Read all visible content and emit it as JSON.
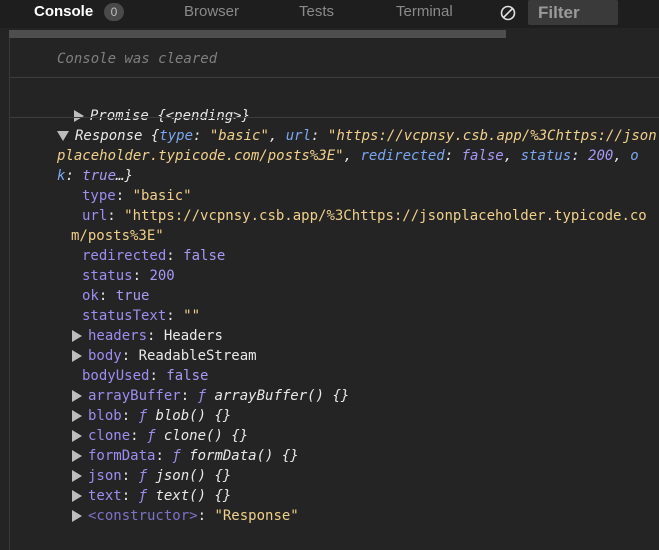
{
  "tabs": {
    "console": "Console",
    "badge": "0",
    "browser": "Browser",
    "tests": "Tests",
    "terminal": "Terminal"
  },
  "filter": {
    "placeholder": "Filter"
  },
  "console": {
    "cleared": "Console was cleared",
    "promise": {
      "label": "Promise",
      "pending": "{<pending>}"
    },
    "response": {
      "label": "Response",
      "summary": {
        "type_key": "type",
        "type_val": "\"basic\"",
        "url_key": "url",
        "url_val_1": "\"https://vcpnsy.csb.app/%3Chttps://json",
        "url_val_2": "placeholder.typicode.com/posts%3E\"",
        "redirected_key": "redirected",
        "redirected_val": "false",
        "status_key": "status",
        "status_val": "200",
        "ok_key_1": "o",
        "ok_key_2": "k",
        "ok_val": "true"
      },
      "props": {
        "type_key": "type",
        "type_val": "\"basic\"",
        "url_key": "url",
        "url_val_1": "\"https://vcpnsy.csb.app/%3Chttps://jsonplaceholder.typicode.co",
        "url_val_2": "m/posts%3E\"",
        "redirected_key": "redirected",
        "redirected_val": "false",
        "status_key": "status",
        "status_val": "200",
        "ok_key": "ok",
        "ok_val": "true",
        "statusText_key": "statusText",
        "statusText_val": "\"\"",
        "headers_key": "headers",
        "headers_val": "Headers",
        "body_key": "body",
        "body_val": "ReadableStream",
        "bodyUsed_key": "bodyUsed",
        "bodyUsed_val": "false",
        "arrayBuffer_key": "arrayBuffer",
        "arrayBuffer_val": "arrayBuffer() {}",
        "blob_key": "blob",
        "blob_val": "blob() {}",
        "clone_key": "clone",
        "clone_val": "clone() {}",
        "formData_key": "formData",
        "formData_val": "formData() {}",
        "json_key": "json",
        "json_val": "json() {}",
        "text_key": "text",
        "text_val": "text() {}",
        "constructor_key": "<constructor>",
        "constructor_val": "\"Response\""
      }
    }
  },
  "colors": {
    "background": "#242424",
    "key": "#9d8ef0",
    "string": "#f0d08a",
    "number": "#a899f5"
  }
}
